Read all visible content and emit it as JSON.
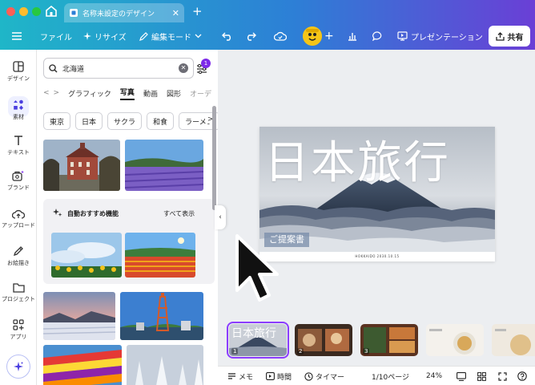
{
  "window": {
    "tab_title": "名称未設定のデザイン",
    "new_tab": "+"
  },
  "toolbar": {
    "file": "ファイル",
    "resize": "リサイズ",
    "edit_mode": "編集モード",
    "add": "+",
    "present": "プレゼンテーション",
    "share": "共有"
  },
  "rail": {
    "items": [
      {
        "label": "デザイン",
        "icon": "layout-icon"
      },
      {
        "label": "素材",
        "icon": "elements-icon"
      },
      {
        "label": "テキスト",
        "icon": "text-icon"
      },
      {
        "label": "ブランド",
        "icon": "brand-icon"
      },
      {
        "label": "アップロード",
        "icon": "upload-icon"
      },
      {
        "label": "お絵描き",
        "icon": "draw-icon"
      },
      {
        "label": "プロジェクト",
        "icon": "folder-icon"
      },
      {
        "label": "アプリ",
        "icon": "apps-icon"
      }
    ]
  },
  "panel": {
    "search_value": "北海道",
    "filter_badge": "1",
    "tabs": [
      "グラフィック",
      "写真",
      "動画",
      "図形",
      "オーデ"
    ],
    "tab_prev": "<",
    "tab_next": ">",
    "active_tab": "写真",
    "chips": [
      "東京",
      "日本",
      "サクラ",
      "和食",
      "ラーメン"
    ],
    "chip_next": ">",
    "recommend_title": "自動おすすめ機能",
    "recommend_all": "すべて表示"
  },
  "slide": {
    "title": "日本旅行",
    "subtitle": "ご提案書",
    "footer": "HOKKAIDO 2030.10.15"
  },
  "thumbnails": [
    {
      "num": "1",
      "selected": true
    },
    {
      "num": "2",
      "selected": false
    },
    {
      "num": "3",
      "selected": false
    },
    {
      "num": "",
      "selected": false
    },
    {
      "num": "",
      "selected": false
    }
  ],
  "bottombar": {
    "notes": "メモ",
    "duration": "時間",
    "timer": "タイマー",
    "page": "1/10ページ",
    "zoom": "24%"
  },
  "colors": {
    "accent": "#8b3dff",
    "header_start": "#1fb6c8",
    "header_end": "#6a3fd6"
  }
}
